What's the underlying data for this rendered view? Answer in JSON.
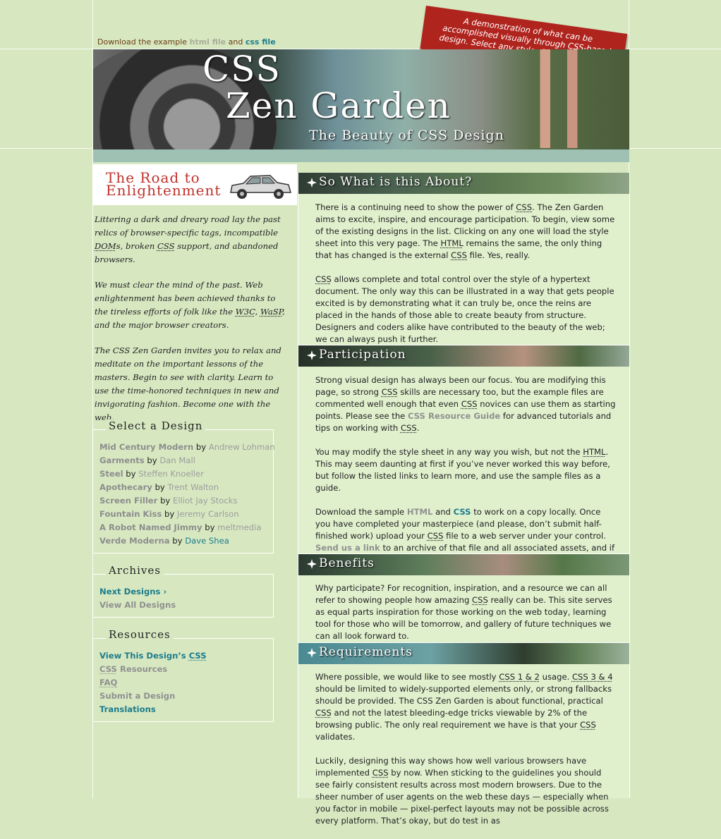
{
  "download": {
    "prefix": "Download the example ",
    "html_link": "html file",
    "middle": " and ",
    "css_link": "css file"
  },
  "tagline": "A demonstration of what can be accomplished visually through CSS-based design. Select any style sheet from the list to load it into this page.",
  "header": {
    "title_line1": "CSS",
    "title_line2": "Zen Garden",
    "subtitle": "The Beauty of CSS Design"
  },
  "road_banner": {
    "line1": "The Road to",
    "line2": "Enlightenment"
  },
  "intro": {
    "p1_a": "Littering a dark and dreary road lay the past relics of browser-specific tags, incompatible ",
    "p1_dom": "DOM",
    "p1_b": "s, broken ",
    "p1_css": "CSS",
    "p1_c": " support, and abandoned browsers.",
    "p2_a": "We must clear the mind of the past. Web enlightenment has been achieved thanks to the tireless efforts of folk like the ",
    "p2_w3c": "W3C",
    "p2_sep": ", ",
    "p2_wasp": "WaSP",
    "p2_c": ", and the major browser creators.",
    "p3": "The CSS Zen Garden invites you to relax and meditate on the important lessons of the masters. Begin to see with clarity. Learn to use the time-honored techniques in new and invigorating fashion. Become one with the web."
  },
  "select_design": {
    "heading": "Select a Design",
    "by_word": "by",
    "items": [
      {
        "name": "Mid Century Modern",
        "author": "Andrew Lohman"
      },
      {
        "name": "Garments",
        "author": "Dan Mall"
      },
      {
        "name": "Steel",
        "author": "Steffen Knoeller"
      },
      {
        "name": "Apothecary",
        "author": "Trent Walton"
      },
      {
        "name": "Screen Filler",
        "author": "Elliot Jay Stocks"
      },
      {
        "name": "Fountain Kiss",
        "author": "Jeremy Carlson"
      },
      {
        "name": "A Robot Named Jimmy",
        "author": "meltmedia"
      },
      {
        "name": "Verde Moderna",
        "author": "Dave Shea"
      }
    ]
  },
  "archives": {
    "heading": "Archives",
    "next": "Next Designs ›",
    "all": "View All Designs"
  },
  "resources": {
    "heading": "Resources",
    "view_css_a": "View This Design’s ",
    "view_css_b": "CSS",
    "css_res_a": "CSS",
    "css_res_b": " Resources",
    "faq": "FAQ",
    "submit": "Submit a Design",
    "translations": "Translations"
  },
  "sections": {
    "about": {
      "title": "So What is this About?",
      "p1_a": "There is a continuing need to show the power of ",
      "p1_b": ". The Zen Garden aims to excite, inspire, and encourage participation. To begin, view some of the existing designs in the list. Clicking on any one will load the style sheet into this very page. The ",
      "p1_c": " remains the same, the only thing that has changed is the external ",
      "p1_d": " file. Yes, really.",
      "p2_b": " allows complete and total control over the style of a hypertext document. The only way this can be illustrated in a way that gets people excited is by demonstrating what it can truly be, once the reins are placed in the hands of those able to create beauty from structure. Designers and coders alike have contributed to the beauty of the web; we can always push it further."
    },
    "participation": {
      "title": "Participation",
      "p1_a": "Strong visual design has always been our focus. You are modifying this page, so strong ",
      "p1_b": " skills are necessary too, but the example files are commented well enough that even ",
      "p1_c": " novices can use them as starting points. Please see the ",
      "p1_link": "CSS Resource Guide",
      "p1_d": " for advanced tutorials and tips on working with ",
      "p1_e": ".",
      "p2_a": "You may modify the style sheet in any way you wish, but not the ",
      "p2_b": ". This may seem daunting at first if you’ve never worked this way before, but follow the listed links to learn more, and use the sample files as a guide.",
      "p3_a": "Download the sample ",
      "p3_html": "HTML",
      "p3_and": " and ",
      "p3_css": "CSS",
      "p3_b": " to work on a copy locally. Once you have completed your masterpiece (and please, don’t submit half-finished work) upload your ",
      "p3_c": " file to a web server under your control. ",
      "p3_link": "Send us a link",
      "p3_d": " to an archive of that file and all associated assets, and if we choose to use it we will download it and place it on our server."
    },
    "benefits": {
      "title": "Benefits",
      "p1_a": "Why participate? For recognition, inspiration, and a resource we can all refer to showing people how amazing ",
      "p1_b": " really can be. This site serves as equal parts inspiration for those working on the web today, learning tool for those who will be tomorrow, and gallery of future techniques we can all look forward to."
    },
    "requirements": {
      "title": "Requirements",
      "p1_a": "Where possible, we would like to see mostly ",
      "p1_css12": "CSS 1 & 2",
      "p1_b": " usage. ",
      "p1_css34": "CSS 3 & 4",
      "p1_c": " should be limited to widely-supported elements only, or strong fallbacks should be provided. The CSS Zen Garden is about functional, practical ",
      "p1_d": " and not the latest bleeding-edge tricks viewable by 2% of the browsing public. The only real requirement we have is that your ",
      "p1_e": " validates.",
      "p2_a": "Luckily, designing this way shows how well various browsers have implemented ",
      "p2_b": " by now. When sticking to the guidelines you should see fairly consistent results across most modern browsers. Due to the sheer number of user agents on the web these days — especially when you factor in mobile — pixel-perfect layouts may not be possible across every platform. That’s okay, but do test in as"
    }
  },
  "abbr": {
    "css": "CSS",
    "html": "HTML"
  },
  "colors": {
    "background": "#d7e8c1",
    "accent_red": "#b0241e",
    "link_teal": "#1d7c8c",
    "link_gray": "#909090"
  }
}
